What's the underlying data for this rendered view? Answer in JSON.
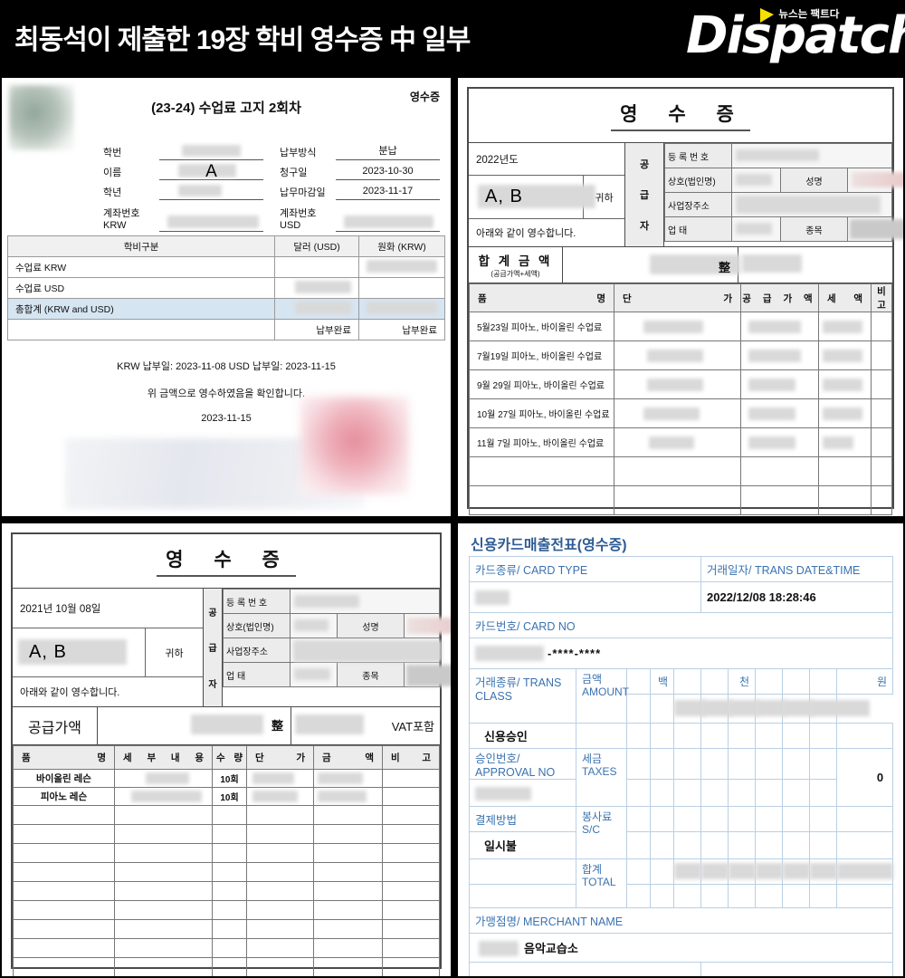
{
  "header": {
    "headline": "최동석이 제출한 19장 학비 영수증 中 일부",
    "logo": {
      "name": "Dispatch",
      "tagline": "뉴스는 팩트다"
    }
  },
  "panel_tuition": {
    "title": "(23-24) 수업료 고지 2회차",
    "receipt_tag": "영수증",
    "fields_left": [
      {
        "label": "학번",
        "value": ""
      },
      {
        "label": "이름",
        "value": "A"
      },
      {
        "label": "학년",
        "value": ""
      },
      {
        "label": "계좌번호 KRW",
        "value": ""
      }
    ],
    "fields_right": [
      {
        "label": "납부방식",
        "value": "분납"
      },
      {
        "label": "청구일",
        "value": "2023-10-30"
      },
      {
        "label": "납무마감일",
        "value": "2023-11-17"
      },
      {
        "label": "계좌번호 USD",
        "value": ""
      }
    ],
    "label_account_krw_1": "계좌번호",
    "label_account_krw_2": "KRW",
    "label_account_usd_1": "계좌번호",
    "label_account_usd_2": "USD",
    "table": {
      "headers": [
        "학비구분",
        "달러 (USD)",
        "원화 (KRW)"
      ],
      "rows": [
        {
          "name": "수업료 KRW",
          "usd": "",
          "krw": ""
        },
        {
          "name": "수업료 USD",
          "usd": "",
          "krw": ""
        },
        {
          "name": "총합계 (KRW and USD)",
          "usd": "",
          "krw": ""
        },
        {
          "name": "",
          "usd": "납부완료",
          "krw": "납부완료"
        }
      ]
    },
    "footer_paid_dates": "KRW 납부일: 2023-11-08    USD 납부일: 2023-11-15",
    "footer_confirm": "위 금액으로 영수하였음을 확인합니다.",
    "footer_date": "2023-11-15"
  },
  "panel_receipt_2022": {
    "title": "영 수 증",
    "year": "2022년도",
    "payer": "A, B",
    "honorific": "귀하",
    "statement": "아래와 같이 영수합니다.",
    "supplier_side": "공 급 자",
    "supplier_rows": [
      {
        "label": "등 록 번 호",
        "value": ""
      },
      {
        "label": "상호(법인명)",
        "value": "",
        "label2": "성명",
        "value2": ""
      },
      {
        "label": "사업장주소",
        "value": ""
      },
      {
        "label": "업      태",
        "value": "",
        "label2": "종목",
        "value2": ""
      }
    ],
    "total_label": "합 계 금 액",
    "total_sub": "(공급가액+세액)",
    "total_jeong": "整",
    "item_headers": [
      "품          명",
      "단                가",
      "공 급 가 액",
      "세      액",
      "비 고"
    ],
    "items": [
      "5월23일 피아노, 바이올린 수업료",
      "7월19일 피아노, 바이올린 수업료",
      "9월 29일 피아노, 바이올린 수업료",
      "10월 27일 피아노, 바이올린 수업료",
      "11월 7일 피아노, 바이올린 수업료",
      "",
      ""
    ]
  },
  "panel_receipt_2021": {
    "title": "영 수 증",
    "date": "2021년 10월 08일",
    "payer": "A, B",
    "honorific": "귀하",
    "statement": "아래와 같이 영수합니다.",
    "supplier_side": "공 급 자",
    "supplier_rows": [
      {
        "label": "등 록 번 호",
        "value": ""
      },
      {
        "label": "상호(법인명)",
        "value": "",
        "label2": "성명",
        "value2": ""
      },
      {
        "label": "사업장주소",
        "value": ""
      },
      {
        "label": "업      태",
        "value": "",
        "label2": "종목",
        "value2": ""
      }
    ],
    "supply_label": "공급가액",
    "jeong": "整",
    "vat_text": "VAT포함",
    "item_headers": [
      "품         명",
      "세  부  내  용",
      "수    량",
      "단         가",
      "금         액",
      "비     고"
    ],
    "items": [
      {
        "name": "바이올린 레슨",
        "detail": "",
        "qty": "10회",
        "unit": "",
        "amount": "",
        "note": ""
      },
      {
        "name": "피아노 레슨",
        "detail": "",
        "qty": "10회",
        "unit": "",
        "amount": "",
        "note": ""
      }
    ],
    "empty_rows": 9
  },
  "panel_card_slip": {
    "title": "신용카드매출전표(영수증)",
    "card_type_label": "카드종류/ CARD TYPE",
    "card_type_value": "",
    "trans_date_label": "거래일자/ TRANS DATE&TIME",
    "trans_date_value": "2022/12/08 18:28:46",
    "card_no_label": "카드번호/ CARD NO",
    "card_no_value": "-****-****",
    "trans_class_label": "거래종류/ TRANS CLASS",
    "trans_class_value": "신용승인",
    "approval_label": "승인번호/ APPROVAL NO",
    "approval_value": "",
    "pay_method_label": "결제방법",
    "pay_method_value": "일시불",
    "amount_label_kr": "금액",
    "amount_label_en": "AMOUNT",
    "taxes_label_kr": "세금",
    "taxes_label_en": "TAXES",
    "taxes_value": "0",
    "sc_label_kr": "봉사료",
    "sc_label_en": "S/C",
    "total_label_kr": "합계",
    "total_label_en": "TOTAL",
    "units": [
      "",
      "백",
      "",
      "",
      "천",
      "",
      "",
      "원"
    ],
    "merchant_label": "가맹점명/ MERCHANT NAME",
    "merchant_value": "음악교습소"
  },
  "colors": {
    "background": "#000000",
    "card_accent": "#3a72b0",
    "total_row": "#d6e5f2",
    "header_gray": "#f0f0f0"
  }
}
